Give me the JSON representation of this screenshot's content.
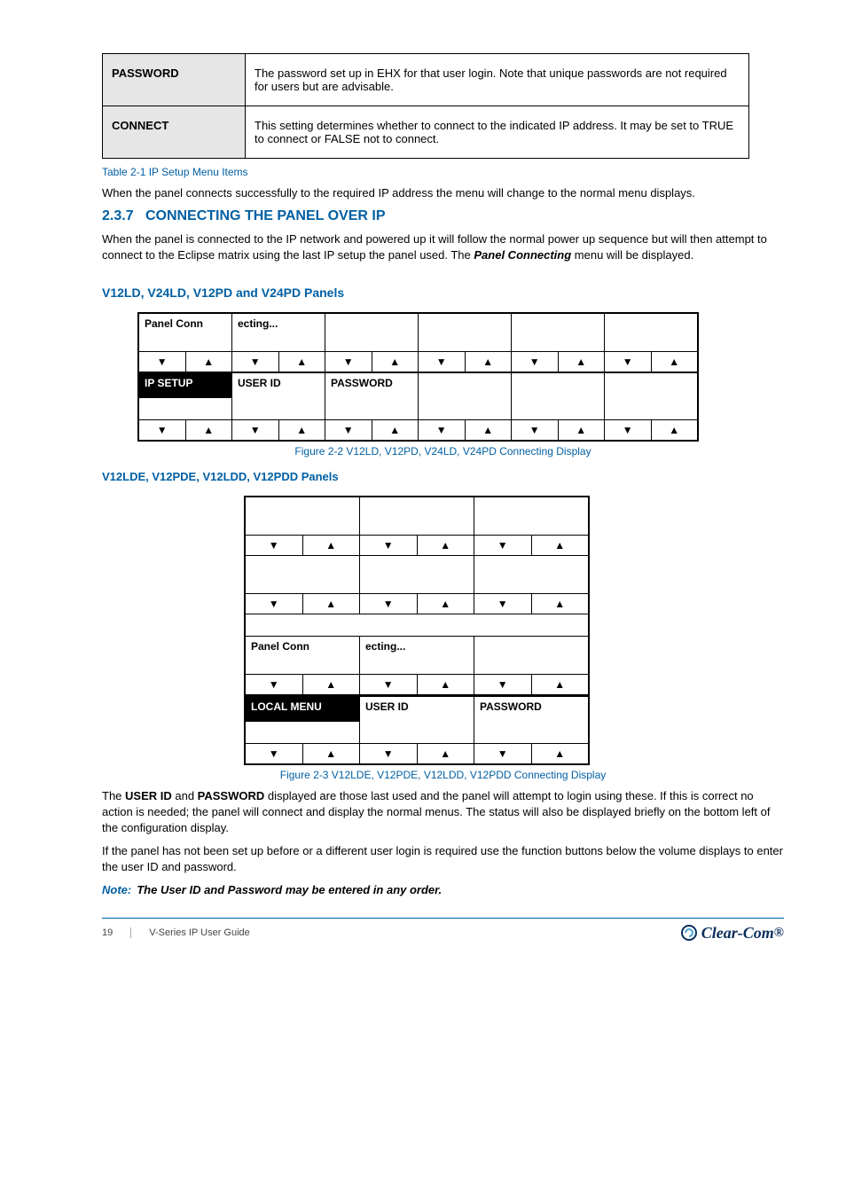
{
  "defs": [
    {
      "key": "PASSWORD",
      "desc": "The password set up in EHX for that user login. Note that unique passwords are not required for users but are advisable."
    },
    {
      "key": "CONNECT",
      "desc": "This setting determines whether to connect to the indicated IP address. It may be set to TRUE to connect or FALSE not to connect."
    }
  ],
  "caption1": "Table 2-1 IP Setup Menu Items",
  "p1": "When the panel connects successfully to the required IP address the menu will change to the normal menu displays.",
  "section_no": "2.3.7",
  "section_title": "CONNECTING THE PANEL OVER IP",
  "p2_pre": "When the panel is connected to the IP network and powered up it will follow the normal power up sequence but will then attempt to connect to the Eclipse matrix using the last IP setup the panel used. The ",
  "p2_cmd": "Panel Connecting ",
  "p2_post": "menu will be displayed.",
  "subsection": "V12LD, V24LD, V12PD and V24PD Panels",
  "fig1_caption": "Figure 2-2 V12LD, V12PD, V24LD, V24PD Connecting Display",
  "subsection2": "V12LDE, V12PDE, V12LDD, V12PDD Panels",
  "fig2_caption": "Figure 2-3 V12LDE, V12PDE, V12LDD, V12PDD Connecting Display",
  "p3_pre": "The ",
  "p3_cmd1": "USER ID",
  "p3_mid": " and ",
  "p3_cmd2": "PASSWORD",
  "p3_post": " displayed are those last used and the panel will attempt to login using these. If this is correct no action is needed; the panel will connect and display the normal menus. The status will also be displayed briefly on the bottom left of the configuration display.",
  "p4": "If the panel has not been set up before or a different user login is required use the function buttons below the volume displays to enter the user ID and password.",
  "note_label": "Note:",
  "note_text": "The User ID and Password may be entered in any order.",
  "panel1": {
    "top": [
      "Panel Conn",
      "ecting...",
      "",
      "",
      "",
      ""
    ],
    "bottom_labels": [
      "IP SETUP",
      "USER ID",
      "PASSWORD",
      "",
      "",
      ""
    ],
    "selected_bottom": 0
  },
  "panel2": {
    "rows_above": 2,
    "third_top": [
      "Panel Conn",
      "ecting...",
      ""
    ],
    "bottom_labels": [
      "LOCAL MENU",
      "USER ID",
      "PASSWORD"
    ],
    "selected_bottom": 0
  },
  "arrow_down": "▼",
  "arrow_up": "▲",
  "footer": {
    "page": "19",
    "doc": "V-Series IP User Guide",
    "brand": "Clear-Com"
  }
}
